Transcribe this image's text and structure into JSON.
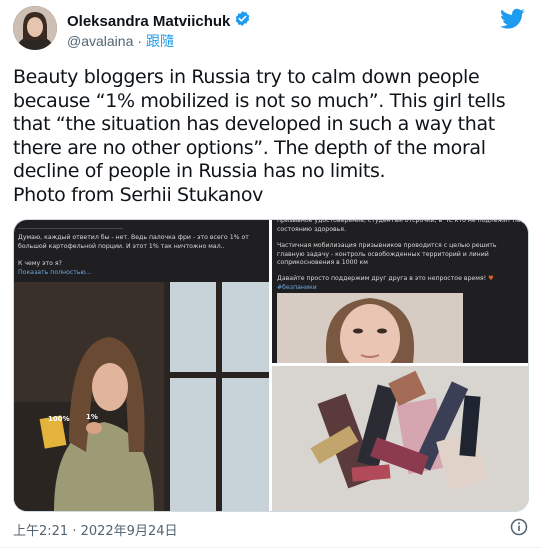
{
  "author": {
    "name": "Oleksandra Matviichuk",
    "handle": "@avalaina",
    "follow_label": "跟隨"
  },
  "tweet": {
    "paragraph1": "Beauty bloggers in Russia try to calm down people because “1% mobilized is not so much”. This girl tells that “the situation has developed in such a way that there are no other options”. The depth of the moral decline of people in Russia has no limits.",
    "paragraph2": "Photo from Serhii Stukanov"
  },
  "media": {
    "left": {
      "caption_top": "Думаю, каждый ответил бы - нет. Ведь палочка фри - это всего 1% от большой картофельной порции. И этот 1% так ничтожно мал..",
      "question": "К чему это я?",
      "show_more": "Показать полностью...",
      "label_fries": "100%",
      "label_one": "1%"
    },
    "top_right": {
      "line0": "призывное удостоверение, студентам отсрочки, в ЧС кто не подлежит по состоянию здоровья.",
      "line1": "Частичная мобилизация призывников проводится с целью решить главную задачу - контроль освобожденных территорий и линий соприкосновения в 1000 км",
      "line2": "Давайте просто поддержим друг друга в это непростое время!",
      "hashtag": "#безпаники"
    }
  },
  "footer": {
    "timestamp": "上午2:21 · 2022年9月24日"
  },
  "colors": {
    "accent": "#1d9bf0",
    "muted": "#536471",
    "verified": "#1d9bf0"
  }
}
